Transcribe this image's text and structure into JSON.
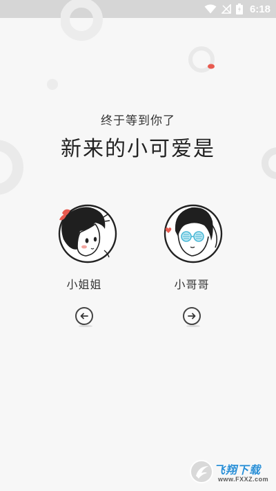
{
  "status_bar": {
    "time": "6:18",
    "icons": [
      "wifi-icon",
      "signal-off-icon",
      "battery-charging-icon"
    ]
  },
  "onboarding": {
    "subtitle": "终于等到你了",
    "title": "新来的小可爱是",
    "options": [
      {
        "label": "小姐姐",
        "avatar": "girl-avatar-icon",
        "arrow": "arrow-left-icon"
      },
      {
        "label": "小哥哥",
        "avatar": "boy-avatar-icon",
        "arrow": "arrow-right-icon"
      }
    ]
  },
  "watermark": {
    "title": "飞翔下载",
    "url": "www.FXXZ.com",
    "brand_color": "#2a8fd6"
  },
  "colors": {
    "background": "#f7f7f7",
    "status_bar": "#d6d6d6",
    "accent_dot": "#e85a4f"
  }
}
